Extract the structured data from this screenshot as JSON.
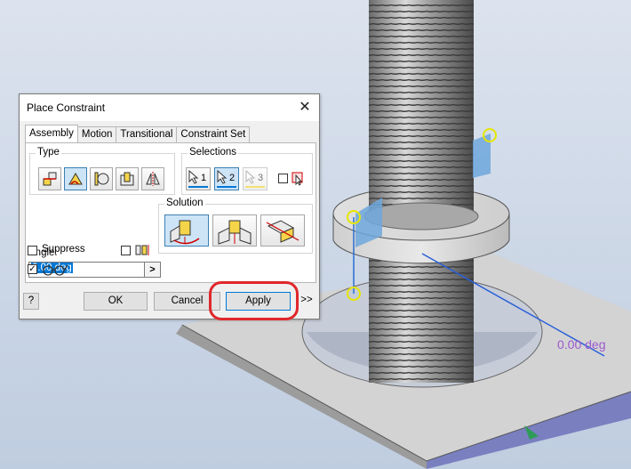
{
  "viewport": {
    "angle_display": "0.00 deg"
  },
  "dialog": {
    "title": "Place Constraint",
    "close_glyph": "✕",
    "tabs": [
      "Assembly",
      "Motion",
      "Transitional",
      "Constraint Set"
    ],
    "active_tab": "Assembly",
    "type_group": {
      "label": "Type",
      "buttons": [
        "mate-icon",
        "angle-icon",
        "tangent-icon",
        "insert-icon",
        "symmetry-icon"
      ],
      "selected": "angle-icon"
    },
    "selections_group": {
      "label": "Selections",
      "selection1": "1",
      "selection2": "2",
      "selection3": "3",
      "selected": "2"
    },
    "angle": {
      "label": "Angle:",
      "value": "0.00 deg",
      "arrow": ">"
    },
    "solution_group": {
      "label": "Solution",
      "options": [
        "directed-angle-icon",
        "undirected-angle-icon",
        "explicit-reference-vector-icon"
      ],
      "selected": "directed-angle-icon"
    },
    "suppress_label": "Suppress",
    "suppress_checked": false,
    "limits_checked": false,
    "preview_checked": true,
    "buttons": {
      "help": "?",
      "ok": "OK",
      "cancel": "Cancel",
      "apply": "Apply",
      "more": ">>"
    },
    "colors": {
      "apply_highlight": "#e0282c",
      "selection_bar": "#0078d7"
    }
  }
}
